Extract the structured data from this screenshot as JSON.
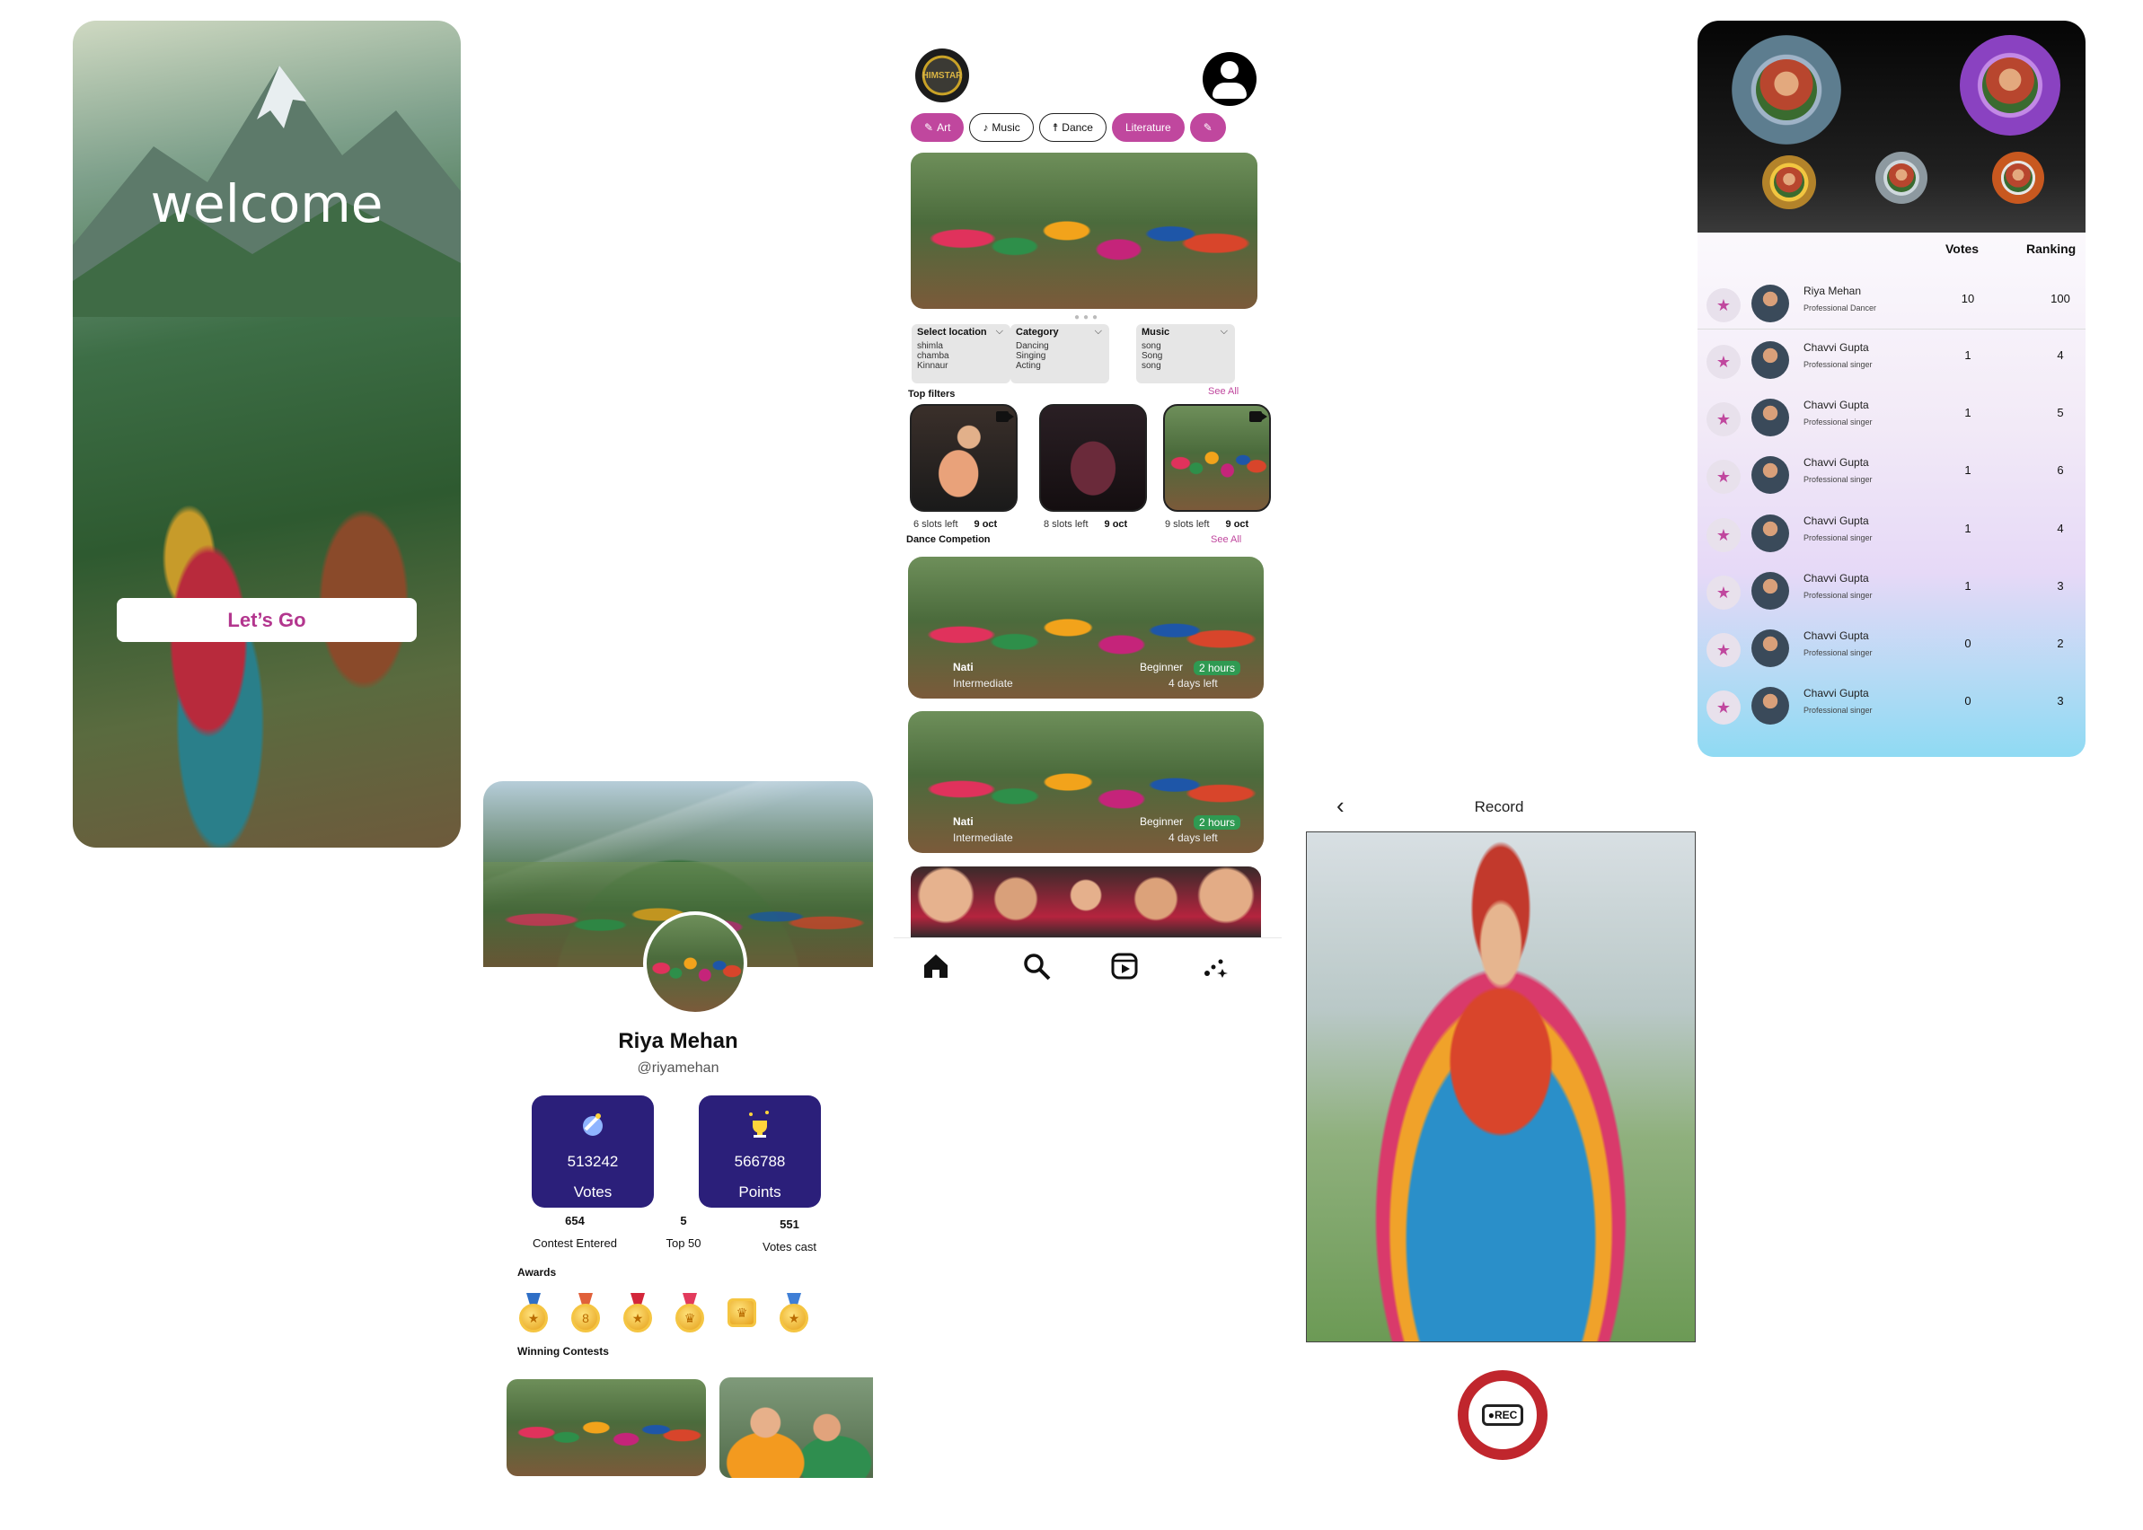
{
  "welcome": {
    "title": "welcome",
    "button": "Let’s Go"
  },
  "profile": {
    "name": "Riya Mehan",
    "handle": "@riyamehan",
    "votes_value": "513242",
    "votes_label": "Votes",
    "points_value": "566788",
    "points_label": "Points",
    "contests_value": "654",
    "contests_label": "Contest Entered",
    "top_value": "5",
    "top_label": "Top 50",
    "cast_value": "551",
    "cast_label": "Votes cast",
    "awards_label": "Awards",
    "winning_label": "Winning Contests"
  },
  "feed": {
    "tabs": [
      "Art",
      "Music",
      "Dance",
      "Literature"
    ],
    "filters": [
      {
        "title": "Select location",
        "options": [
          "shimla",
          "chamba",
          "Kinnaur"
        ]
      },
      {
        "title": "Category",
        "options": [
          "Dancing",
          "Singing",
          "Acting"
        ]
      },
      {
        "title": "Music",
        "options": [
          "song",
          "Song",
          "song"
        ]
      }
    ],
    "top_filters_label": "Top  filters",
    "see_all": "See All",
    "thumbs": [
      {
        "slots": "6 slots left",
        "date": "9 oct"
      },
      {
        "slots": "8 slots left",
        "date": "9 oct"
      },
      {
        "slots": "9 slots left",
        "date": "9 oct"
      }
    ],
    "dance_label": "Dance Competion",
    "competitions": [
      {
        "name": "Nati",
        "level": "Intermediate",
        "tier": "Beginner",
        "duration": "2 hours",
        "left": "4 days left"
      },
      {
        "name": "Nati",
        "level": "Intermediate",
        "tier": "Beginner",
        "duration": "2 hours",
        "left": "4 days left"
      }
    ],
    "logo_text": "HIMSTAR"
  },
  "record": {
    "title": "Record",
    "rec_label": "●REC"
  },
  "leader": {
    "votes_header": "Votes",
    "ranking_header": "Ranking",
    "rows": [
      {
        "name": "Riya Mehan",
        "role": "Professional  Dancer",
        "votes": "10",
        "rank": "100"
      },
      {
        "name": "Chavvi  Gupta",
        "role": "Professional singer",
        "votes": "1",
        "rank": "4"
      },
      {
        "name": "Chavvi  Gupta",
        "role": "Professional singer",
        "votes": "1",
        "rank": "5"
      },
      {
        "name": "Chavvi  Gupta",
        "role": "Professional singer",
        "votes": "1",
        "rank": "6"
      },
      {
        "name": "Chavvi  Gupta",
        "role": "Professional singer",
        "votes": "1",
        "rank": "4"
      },
      {
        "name": "Chavvi  Gupta",
        "role": "Professional singer",
        "votes": "1",
        "rank": "3"
      },
      {
        "name": "Chavvi  Gupta",
        "role": "Professional singer",
        "votes": "0",
        "rank": "2"
      },
      {
        "name": "Chavvi  Gupta",
        "role": "Professional singer",
        "votes": "0",
        "rank": "3"
      }
    ]
  },
  "colors": {
    "accent": "#c0479e",
    "stat_card": "#2b1f7a",
    "rec_ring": "#c0262d",
    "badge": "#2f9a52"
  }
}
